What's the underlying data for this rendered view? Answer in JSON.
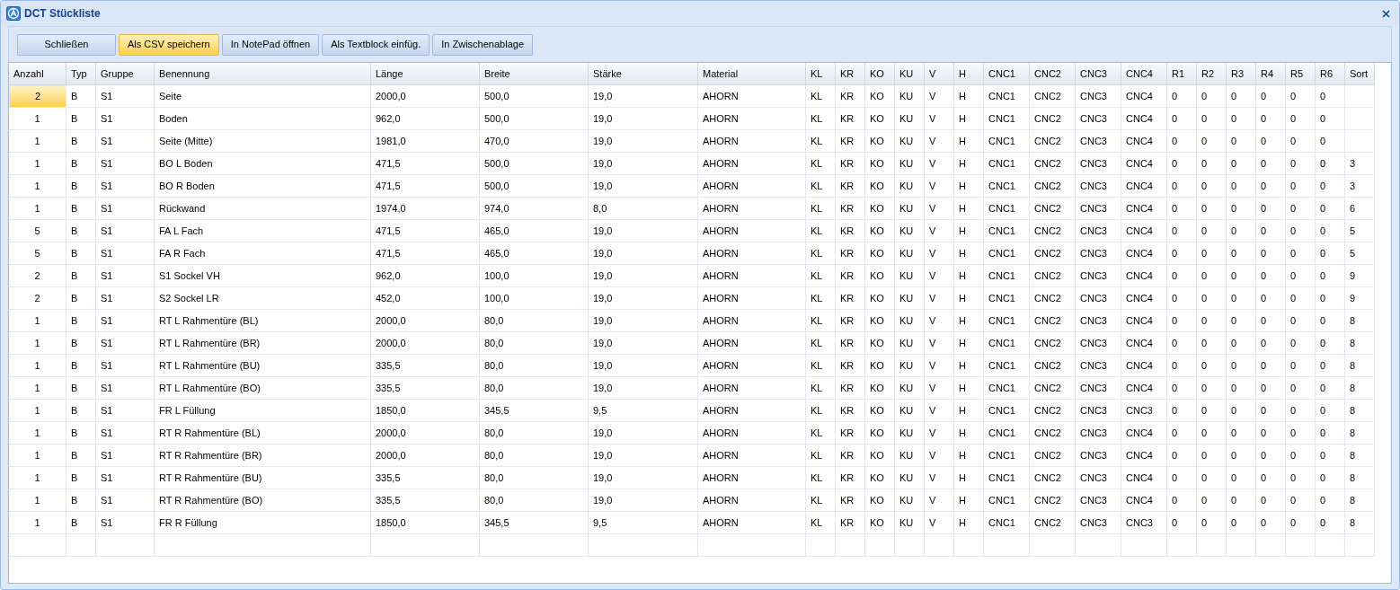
{
  "window": {
    "title": "DCT Stückliste"
  },
  "toolbar": [
    {
      "label": "Schließen",
      "highlighted": false
    },
    {
      "label": "Als CSV speichern",
      "highlighted": true
    },
    {
      "label": "In NotePad öffnen",
      "highlighted": false
    },
    {
      "label": "Als Textblock einfüg.",
      "highlighted": false
    },
    {
      "label": "In Zwischenablage",
      "highlighted": false
    }
  ],
  "table": {
    "columns": [
      "Anzahl",
      "Typ",
      "Gruppe",
      "Benennung",
      "Länge",
      "Breite",
      "Stärke",
      "Material",
      "KL",
      "KR",
      "KO",
      "KU",
      "V",
      "H",
      "CNC1",
      "CNC2",
      "CNC3",
      "CNC4",
      "R1",
      "R2",
      "R3",
      "R4",
      "R5",
      "R6",
      "Sort"
    ],
    "rows": [
      {
        "selected": true,
        "cells": [
          "2",
          "B",
          "S1",
          "Seite",
          "2000,0",
          "500,0",
          "19,0",
          "AHORN",
          "KL",
          "KR",
          "KO",
          "KU",
          "V",
          "H",
          "CNC1",
          "CNC2",
          "CNC3",
          "CNC4",
          "0",
          "0",
          "0",
          "0",
          "0",
          "0"
        ]
      },
      {
        "selected": false,
        "cells": [
          "1",
          "B",
          "S1",
          "Boden",
          "962,0",
          "500,0",
          "19,0",
          "AHORN",
          "KL",
          "KR",
          "KO",
          "KU",
          "V",
          "H",
          "CNC1",
          "CNC2",
          "CNC3",
          "CNC4",
          "0",
          "0",
          "0",
          "0",
          "0",
          "0"
        ]
      },
      {
        "selected": false,
        "cells": [
          "1",
          "B",
          "S1",
          "Seite (Mitte)",
          "1981,0",
          "470,0",
          "19,0",
          "AHORN",
          "KL",
          "KR",
          "KO",
          "KU",
          "V",
          "H",
          "CNC1",
          "CNC2",
          "CNC3",
          "CNC4",
          "0",
          "0",
          "0",
          "0",
          "0",
          "0"
        ]
      },
      {
        "selected": false,
        "cells": [
          "1",
          "B",
          "S1",
          "BO L Boden",
          "471,5",
          "500,0",
          "19,0",
          "AHORN",
          "KL",
          "KR",
          "KO",
          "KU",
          "V",
          "H",
          "CNC1",
          "CNC2",
          "CNC3",
          "CNC4",
          "0",
          "0",
          "0",
          "0",
          "0",
          "0",
          "3"
        ]
      },
      {
        "selected": false,
        "cells": [
          "1",
          "B",
          "S1",
          "BO R Boden",
          "471,5",
          "500,0",
          "19,0",
          "AHORN",
          "KL",
          "KR",
          "KO",
          "KU",
          "V",
          "H",
          "CNC1",
          "CNC2",
          "CNC3",
          "CNC4",
          "0",
          "0",
          "0",
          "0",
          "0",
          "0",
          "3"
        ]
      },
      {
        "selected": false,
        "cells": [
          "1",
          "B",
          "S1",
          "Rückwand",
          "1974,0",
          "974,0",
          "8,0",
          "AHORN",
          "KL",
          "KR",
          "KO",
          "KU",
          "V",
          "H",
          "CNC1",
          "CNC2",
          "CNC3",
          "CNC4",
          "0",
          "0",
          "0",
          "0",
          "0",
          "0",
          "6"
        ]
      },
      {
        "selected": false,
        "cells": [
          "5",
          "B",
          "S1",
          "FA L Fach",
          "471,5",
          "465,0",
          "19,0",
          "AHORN",
          "KL",
          "KR",
          "KO",
          "KU",
          "V",
          "H",
          "CNC1",
          "CNC2",
          "CNC3",
          "CNC4",
          "0",
          "0",
          "0",
          "0",
          "0",
          "0",
          "5"
        ]
      },
      {
        "selected": false,
        "cells": [
          "5",
          "B",
          "S1",
          "FA R Fach",
          "471,5",
          "465,0",
          "19,0",
          "AHORN",
          "KL",
          "KR",
          "KO",
          "KU",
          "V",
          "H",
          "CNC1",
          "CNC2",
          "CNC3",
          "CNC4",
          "0",
          "0",
          "0",
          "0",
          "0",
          "0",
          "5"
        ]
      },
      {
        "selected": false,
        "cells": [
          "2",
          "B",
          "S1",
          "S1 Sockel VH",
          "962,0",
          "100,0",
          "19,0",
          "AHORN",
          "KL",
          "KR",
          "KO",
          "KU",
          "V",
          "H",
          "CNC1",
          "CNC2",
          "CNC3",
          "CNC4",
          "0",
          "0",
          "0",
          "0",
          "0",
          "0",
          "9"
        ]
      },
      {
        "selected": false,
        "cells": [
          "2",
          "B",
          "S1",
          "S2 Sockel LR",
          "452,0",
          "100,0",
          "19,0",
          "AHORN",
          "KL",
          "KR",
          "KO",
          "KU",
          "V",
          "H",
          "CNC1",
          "CNC2",
          "CNC3",
          "CNC4",
          "0",
          "0",
          "0",
          "0",
          "0",
          "0",
          "9"
        ]
      },
      {
        "selected": false,
        "cells": [
          "1",
          "B",
          "S1",
          "RT L Rahmentüre (BL)",
          "2000,0",
          "80,0",
          "19,0",
          "AHORN",
          "KL",
          "KR",
          "KO",
          "KU",
          "V",
          "H",
          "CNC1",
          "CNC2",
          "CNC3",
          "CNC4",
          "0",
          "0",
          "0",
          "0",
          "0",
          "0",
          "8"
        ]
      },
      {
        "selected": false,
        "cells": [
          "1",
          "B",
          "S1",
          "RT L Rahmentüre (BR)",
          "2000,0",
          "80,0",
          "19,0",
          "AHORN",
          "KL",
          "KR",
          "KO",
          "KU",
          "V",
          "H",
          "CNC1",
          "CNC2",
          "CNC3",
          "CNC4",
          "0",
          "0",
          "0",
          "0",
          "0",
          "0",
          "8"
        ]
      },
      {
        "selected": false,
        "cells": [
          "1",
          "B",
          "S1",
          "RT L Rahmentüre (BU)",
          "335,5",
          "80,0",
          "19,0",
          "AHORN",
          "KL",
          "KR",
          "KO",
          "KU",
          "V",
          "H",
          "CNC1",
          "CNC2",
          "CNC3",
          "CNC4",
          "0",
          "0",
          "0",
          "0",
          "0",
          "0",
          "8"
        ]
      },
      {
        "selected": false,
        "cells": [
          "1",
          "B",
          "S1",
          "RT L Rahmentüre (BO)",
          "335,5",
          "80,0",
          "19,0",
          "AHORN",
          "KL",
          "KR",
          "KO",
          "KU",
          "V",
          "H",
          "CNC1",
          "CNC2",
          "CNC3",
          "CNC4",
          "0",
          "0",
          "0",
          "0",
          "0",
          "0",
          "8"
        ]
      },
      {
        "selected": false,
        "cells": [
          "1",
          "B",
          "S1",
          "FR L Füllung",
          "1850,0",
          "345,5",
          "9,5",
          "AHORN",
          "KL",
          "KR",
          "KO",
          "KU",
          "V",
          "H",
          "CNC1",
          "CNC2",
          "CNC3",
          "CNC3",
          "0",
          "0",
          "0",
          "0",
          "0",
          "0",
          "8"
        ]
      },
      {
        "selected": false,
        "cells": [
          "1",
          "B",
          "S1",
          "RT R Rahmentüre (BL)",
          "2000,0",
          "80,0",
          "19,0",
          "AHORN",
          "KL",
          "KR",
          "KO",
          "KU",
          "V",
          "H",
          "CNC1",
          "CNC2",
          "CNC3",
          "CNC4",
          "0",
          "0",
          "0",
          "0",
          "0",
          "0",
          "8"
        ]
      },
      {
        "selected": false,
        "cells": [
          "1",
          "B",
          "S1",
          "RT R Rahmentüre (BR)",
          "2000,0",
          "80,0",
          "19,0",
          "AHORN",
          "KL",
          "KR",
          "KO",
          "KU",
          "V",
          "H",
          "CNC1",
          "CNC2",
          "CNC3",
          "CNC4",
          "0",
          "0",
          "0",
          "0",
          "0",
          "0",
          "8"
        ]
      },
      {
        "selected": false,
        "cells": [
          "1",
          "B",
          "S1",
          "RT R Rahmentüre (BU)",
          "335,5",
          "80,0",
          "19,0",
          "AHORN",
          "KL",
          "KR",
          "KO",
          "KU",
          "V",
          "H",
          "CNC1",
          "CNC2",
          "CNC3",
          "CNC4",
          "0",
          "0",
          "0",
          "0",
          "0",
          "0",
          "8"
        ]
      },
      {
        "selected": false,
        "cells": [
          "1",
          "B",
          "S1",
          "RT R Rahmentüre (BO)",
          "335,5",
          "80,0",
          "19,0",
          "AHORN",
          "KL",
          "KR",
          "KO",
          "KU",
          "V",
          "H",
          "CNC1",
          "CNC2",
          "CNC3",
          "CNC4",
          "0",
          "0",
          "0",
          "0",
          "0",
          "0",
          "8"
        ]
      },
      {
        "selected": false,
        "cells": [
          "1",
          "B",
          "S1",
          "FR R Füllung",
          "1850,0",
          "345,5",
          "9,5",
          "AHORN",
          "KL",
          "KR",
          "KO",
          "KU",
          "V",
          "H",
          "CNC1",
          "CNC2",
          "CNC3",
          "CNC3",
          "0",
          "0",
          "0",
          "0",
          "0",
          "0",
          "8"
        ]
      }
    ]
  }
}
